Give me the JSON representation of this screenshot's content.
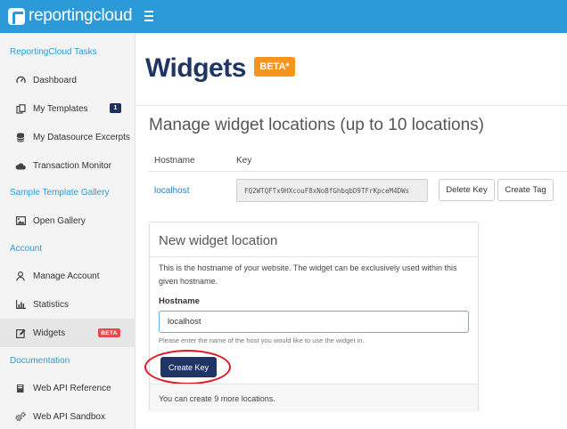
{
  "app": {
    "logo_text": "reportingcloud"
  },
  "sidebar": {
    "sections": [
      {
        "title": "ReportingCloud Tasks"
      },
      {
        "title": "Sample Template Gallery"
      },
      {
        "title": "Account"
      },
      {
        "title": "Documentation"
      }
    ],
    "items": [
      {
        "label": "Dashboard",
        "icon": "dashboard-icon"
      },
      {
        "label": "My Templates",
        "icon": "templates-icon",
        "badge": "1"
      },
      {
        "label": "My Datasource Excerpts",
        "icon": "database-icon"
      },
      {
        "label": "Transaction Monitor",
        "icon": "cloud-icon"
      },
      {
        "label": "Open Gallery",
        "icon": "image-icon"
      },
      {
        "label": "Manage Account",
        "icon": "user-icon"
      },
      {
        "label": "Statistics",
        "icon": "bar-chart-icon"
      },
      {
        "label": "Widgets",
        "icon": "edit-icon",
        "badge": "BETA",
        "active": true
      },
      {
        "label": "Web API Reference",
        "icon": "book-icon"
      },
      {
        "label": "Web API Sandbox",
        "icon": "gears-icon"
      }
    ]
  },
  "main": {
    "title": "Widgets",
    "title_badge": "BETA*",
    "section_title": "Manage widget locations (up to 10 locations)",
    "table": {
      "headers": [
        "Hostname",
        "Key"
      ],
      "rows": [
        {
          "hostname": "localhost",
          "key": "FQ2WTQFTx9HXcouF8xNoBfGhbqbD9TFrKpceM4DWs",
          "delete_label": "Delete Key",
          "create_tag_label": "Create Tag"
        }
      ]
    },
    "new_location": {
      "title": "New widget location",
      "description": "This is the hostname of your website. The widget can be exclusively used within this given hostname.",
      "field_label": "Hostname",
      "field_value": "localhost",
      "field_help": "Please enter the name of the host you would like to use the widget in.",
      "button_label": "Create Key",
      "footer": "You can create 9 more locations."
    }
  },
  "colors": {
    "topbar": "#2c9ad9",
    "brand_navy": "#1f3564",
    "beta_orange": "#f7941d",
    "beta_red": "#e84a4a",
    "highlight_ring": "#e0171f"
  }
}
